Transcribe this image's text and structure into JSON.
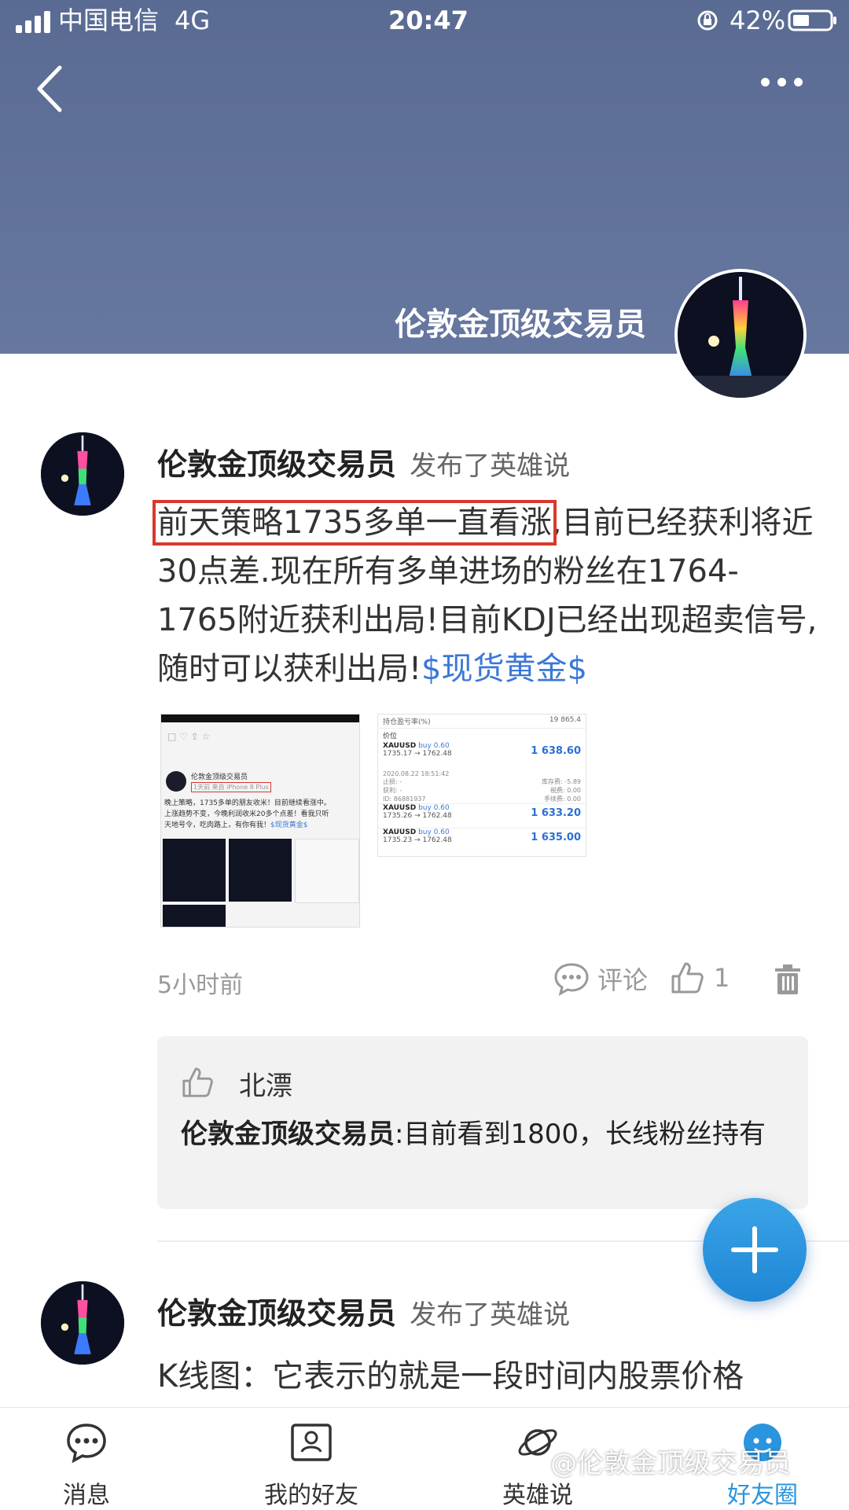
{
  "status_bar": {
    "carrier": "中国电信",
    "network": "4G",
    "time": "20:47",
    "battery": "42%"
  },
  "header": {
    "title": "伦敦金顶级交易员"
  },
  "post1": {
    "author": "伦敦金顶级交易员",
    "action": "发布了英雄说",
    "text_highlight": "前天策略1735多单一直看涨",
    "text_rest": ",目前已经获利将近30点差.现在所有多单进场的粉丝在1764-1765附近获利出局!目前KDJ已经出现超卖信号,随时可以获利出局!",
    "tag": "$现货黄金$",
    "thumb1": {
      "name": "伦敦金顶级交易员",
      "meta": "1天前 来自 iPhone 8 Plus",
      "line1": "晚上策略，1735多单的朋友收米！目前继续看涨中。",
      "line2": "上涨趋势不变，今晚利润收米20多个点差！看我只听",
      "line3": "天地号令，吃肉路上，有你有我！",
      "tag": "$现货黄金$"
    },
    "thumb2": {
      "header_label": "持仓盈亏率(%)",
      "header_value": "19 865.4",
      "col_label": "价位",
      "rows": [
        {
          "symbol": "XAUUSD",
          "side": "buy 0.60",
          "range": "1735.17 → 1762.48",
          "value": "1 638.60"
        },
        {
          "symbol": "XAUUSD",
          "side": "buy 0.60",
          "range": "1735.26 → 1762.48",
          "value": "1 633.20"
        },
        {
          "symbol": "XAUUSD",
          "side": "buy 0.60",
          "range": "1735.23 → 1762.48",
          "value": "1 635.00"
        }
      ],
      "date": "2020.08.22 18:51:42",
      "details": [
        {
          "k": "止损:",
          "v": "-",
          "k2": "库存费:",
          "v2": "-5.89"
        },
        {
          "k": "获利:",
          "v": "-",
          "k2": "税费:",
          "v2": "0.00"
        },
        {
          "k": "ID:",
          "v": "86881937",
          "k2": "手续费:",
          "v2": "0.00"
        }
      ]
    },
    "time": "5小时前",
    "comment_label": "评论",
    "like_count": "1",
    "comment": {
      "liker": "北漂",
      "author": "伦敦金顶级交易员",
      "text": ":目前看到1800，长线粉丝持有"
    }
  },
  "post2": {
    "author": "伦敦金顶级交易员",
    "action": "发布了英雄说",
    "text": "K线图：它表示的就是一段时间内股票价格"
  },
  "tabbar": {
    "tabs": [
      {
        "label": "消息"
      },
      {
        "label": "我的好友"
      },
      {
        "label": "英雄说"
      },
      {
        "label": "好友圈"
      }
    ]
  },
  "watermark": "@伦敦金顶级交易员",
  "colors": {
    "header_bg": "#5a6b93",
    "link": "#3b78d8",
    "highlight_border": "#d9382d",
    "fab": "#2a95de",
    "active_tab": "#2a95de"
  }
}
